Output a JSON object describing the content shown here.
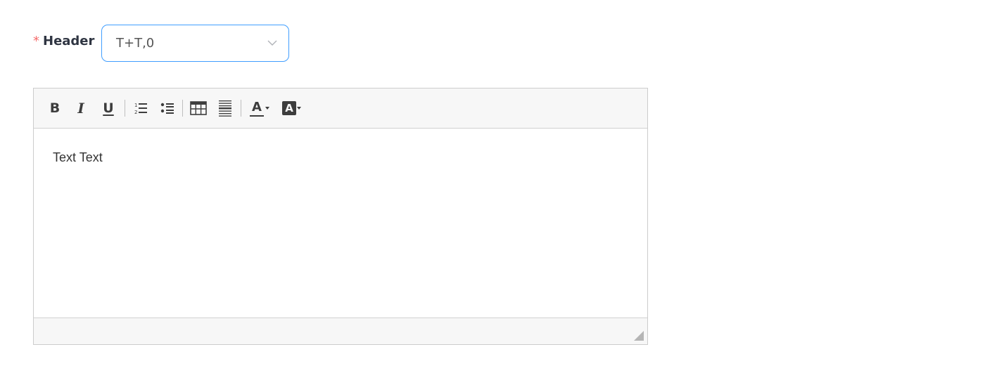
{
  "form": {
    "required_mark": "*",
    "label": "Header",
    "select": {
      "value": "T+T,0"
    }
  },
  "editor": {
    "toolbar": [
      {
        "name": "bold-button",
        "icon": "bold-icon",
        "glyph": "B"
      },
      {
        "name": "italic-button",
        "icon": "italic-icon",
        "glyph": "I"
      },
      {
        "name": "underline-button",
        "icon": "underline-icon",
        "glyph": "U"
      },
      {
        "name": "numbered-list-button",
        "icon": "numbered-list-icon"
      },
      {
        "name": "bullet-list-button",
        "icon": "bullet-list-icon"
      },
      {
        "name": "table-button",
        "icon": "table-icon"
      },
      {
        "name": "horizontal-rule-button",
        "icon": "horizontal-rule-icon"
      },
      {
        "name": "text-color-button",
        "icon": "text-color-icon",
        "glyph": "A"
      },
      {
        "name": "background-color-button",
        "icon": "background-color-icon",
        "glyph": "A"
      }
    ],
    "content": "Text Text"
  },
  "colors": {
    "accent": "#409eff",
    "required": "#f56c6c",
    "toolbar_bg": "#f7f7f7",
    "border": "#cccccc"
  }
}
